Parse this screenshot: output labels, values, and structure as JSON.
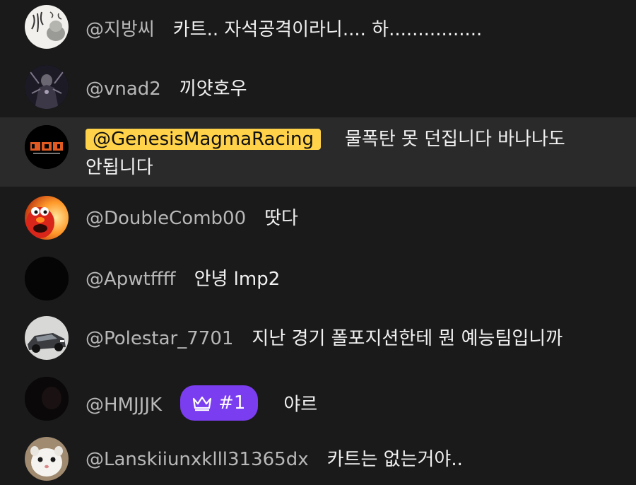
{
  "chat": {
    "messages": [
      {
        "author": "@지방씨",
        "text": "카트.. 자석공격이라니.... 하................"
      },
      {
        "author": "@vnad2",
        "text": "끼얏호우"
      },
      {
        "author": "@GenesisMagmaRacing",
        "text": "물폭탄 못 던집니다 바나나도",
        "text_cont": "안됩니다",
        "is_owner": true
      },
      {
        "author": "@DoubleComb00",
        "text": "땃다"
      },
      {
        "author": "@Apwtffff",
        "text": "안녕 lmp2"
      },
      {
        "author": "@Polestar_7701",
        "text": "지난 경기 폴포지션한테 뭔 예능팀입니까"
      },
      {
        "author": "@HMJJJK",
        "text": "야르",
        "badge": "#1"
      },
      {
        "author": "@Lanskiiunxklll31365dx",
        "text": "카트는 없는거야.."
      }
    ]
  },
  "colors": {
    "background": "#1a1a1a",
    "highlight_row": "#2a2a2a",
    "owner_badge": "#ffd24a",
    "member_badge": "#7b3df0",
    "author_text": "#b8b8b8"
  }
}
